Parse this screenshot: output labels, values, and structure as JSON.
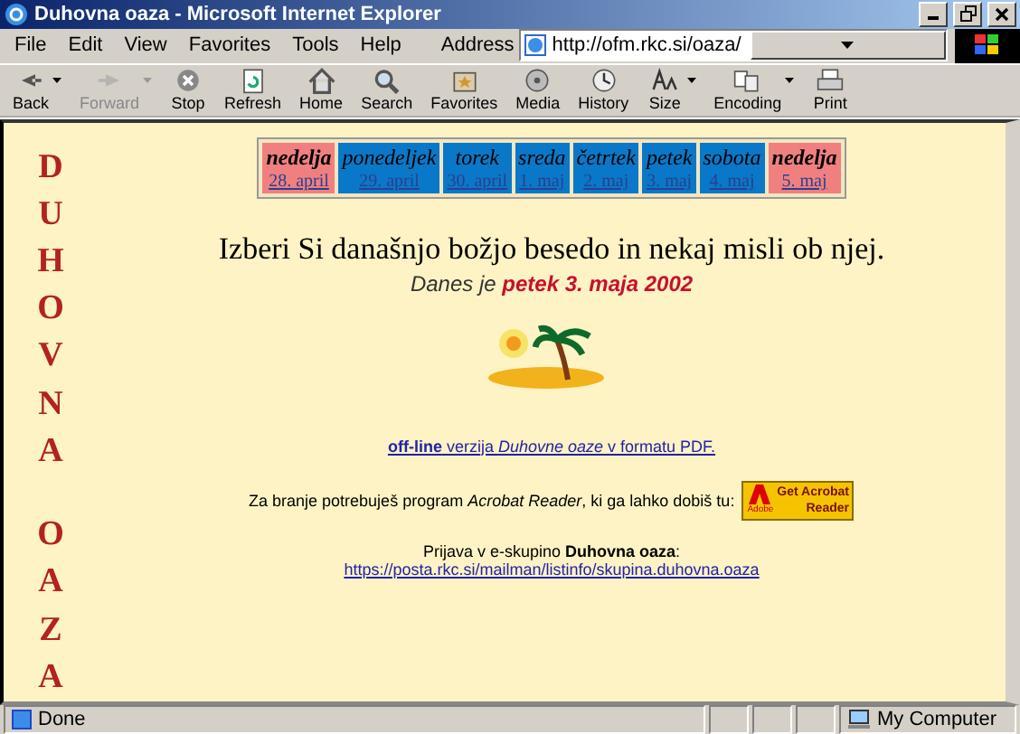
{
  "window": {
    "title": "Duhovna oaza - Microsoft Internet Explorer"
  },
  "menu": [
    "File",
    "Edit",
    "View",
    "Favorites",
    "Tools",
    "Help"
  ],
  "address": {
    "label": "Address",
    "value": "http://ofm.rkc.si/oaza/"
  },
  "toolbar": [
    {
      "label": "Back",
      "kind": "back",
      "disabled": false,
      "dropdown": true
    },
    {
      "label": "Forward",
      "kind": "forward",
      "disabled": true,
      "dropdown": true
    },
    {
      "label": "Stop",
      "kind": "stop",
      "disabled": false,
      "dropdown": false
    },
    {
      "label": "Refresh",
      "kind": "refresh",
      "disabled": false,
      "dropdown": false
    },
    {
      "label": "Home",
      "kind": "home",
      "disabled": false,
      "dropdown": false
    },
    {
      "label": "Search",
      "kind": "search",
      "disabled": false,
      "dropdown": false
    },
    {
      "label": "Favorites",
      "kind": "favorites",
      "disabled": false,
      "dropdown": false
    },
    {
      "label": "Media",
      "kind": "media",
      "disabled": false,
      "dropdown": false
    },
    {
      "label": "History",
      "kind": "history",
      "disabled": false,
      "dropdown": false
    },
    {
      "label": "Size",
      "kind": "size",
      "disabled": false,
      "dropdown": true
    },
    {
      "label": "Encoding",
      "kind": "encoding",
      "disabled": false,
      "dropdown": true
    },
    {
      "label": "Print",
      "kind": "print",
      "disabled": false,
      "dropdown": false
    }
  ],
  "side_title": [
    "DUHOVNA",
    "OAZA"
  ],
  "days": [
    {
      "name": "nedelja",
      "date": "28. april",
      "kind": "sunday",
      "color": "#f08080"
    },
    {
      "name": "ponedeljek",
      "date": "29. april",
      "kind": "weekday",
      "color": "#0a78c8"
    },
    {
      "name": "torek",
      "date": "30. april",
      "kind": "weekday",
      "color": "#0a78c8"
    },
    {
      "name": "sreda",
      "date": "1. maj",
      "kind": "weekday",
      "color": "#0a78c8"
    },
    {
      "name": "četrtek",
      "date": "2. maj",
      "kind": "weekday",
      "color": "#0a78c8"
    },
    {
      "name": "petek",
      "date": "3. maj",
      "kind": "weekday",
      "color": "#0a78c8"
    },
    {
      "name": "sobota",
      "date": "4. maj",
      "kind": "weekday",
      "color": "#0a78c8"
    },
    {
      "name": "nedelja",
      "date": "5. maj",
      "kind": "sunday",
      "color": "#f08080"
    }
  ],
  "heading": "Izberi Si današnjo božjo besedo in nekaj misli ob njej.",
  "today": "Danes je **petek 3. maja 2002**",
  "pdf_link": "**off-line** verzija *Duhovne oaze* v formatu PDF.",
  "acrobat_text": "Za branje potrebuješ program *Acrobat Reader*, ki ga lahko dobiš tu:",
  "acrobat_badge": {
    "line_1": "Get Acrobat",
    "line_2": "Reader",
    "logo": "Adobe"
  },
  "signup_text": "Prijava v e-skupino **Duhovna oaza**:",
  "signup_link": "https://posta.rkc.si/mailman/listinfo/skupina.duhovna.oaza",
  "status_bar": {
    "text": "Done",
    "zone": "My Computer"
  }
}
